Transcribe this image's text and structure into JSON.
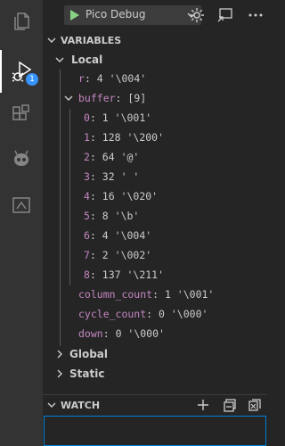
{
  "run": {
    "config_label": "Pico Debug"
  },
  "variables": {
    "header": "VARIABLES",
    "local": {
      "label": "Local",
      "items": [
        {
          "name": "r",
          "value": "4 '\\004'"
        }
      ],
      "buffer": {
        "name": "buffer",
        "type": "[9]",
        "children": [
          {
            "name": "0",
            "value": "1 '\\001'"
          },
          {
            "name": "1",
            "value": "128 '\\200'"
          },
          {
            "name": "2",
            "value": "64 '@'"
          },
          {
            "name": "3",
            "value": "32 ' '"
          },
          {
            "name": "4",
            "value": "16 '\\020'"
          },
          {
            "name": "5",
            "value": "8 '\\b'"
          },
          {
            "name": "6",
            "value": "4 '\\004'"
          },
          {
            "name": "7",
            "value": "2 '\\002'"
          },
          {
            "name": "8",
            "value": "137 '\\211'"
          }
        ]
      },
      "after": [
        {
          "name": "column_count",
          "value": "1 '\\001'"
        },
        {
          "name": "cycle_count",
          "value": "0 '\\000'"
        },
        {
          "name": "down",
          "value": "0 '\\000'"
        }
      ]
    },
    "global_label": "Global",
    "static_label": "Static"
  },
  "watch": {
    "header": "WATCH"
  },
  "activity": {
    "debug_badge": "1"
  }
}
